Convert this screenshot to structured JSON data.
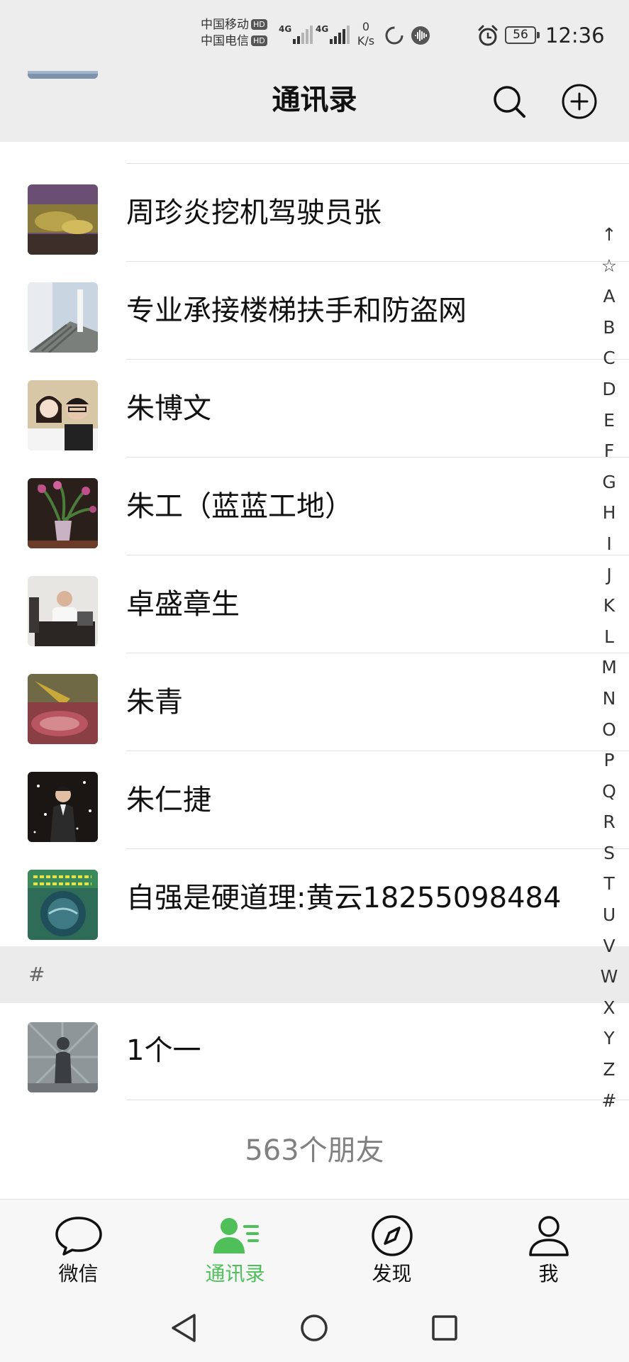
{
  "status_bar": {
    "carrier_1": "中国移动",
    "carrier_2": "中国电信",
    "hd_badge": "HD",
    "network_1": "4G",
    "network_2": "4G",
    "speed_value": "0",
    "speed_unit": "K/s",
    "battery": "56",
    "time": "12:36"
  },
  "header": {
    "title": "通讯录",
    "search_icon": "search-icon",
    "add_icon": "plus-circle-icon"
  },
  "contacts": [
    {
      "name": "周珍炎挖机驾驶员张"
    },
    {
      "name": "专业承接楼梯扶手和防盗网"
    },
    {
      "name": "朱博文"
    },
    {
      "name": "朱工（蓝蓝工地）"
    },
    {
      "name": "卓盛章生"
    },
    {
      "name": "朱青"
    },
    {
      "name": "朱仁捷"
    },
    {
      "name": "自强是硬道理:黄云18255098484"
    }
  ],
  "section_hash": {
    "label": "#",
    "contacts": [
      {
        "name": "1个一"
      }
    ]
  },
  "friend_count": "563个朋友",
  "index_letters": [
    "↑",
    "☆",
    "A",
    "B",
    "C",
    "D",
    "E",
    "F",
    "G",
    "H",
    "I",
    "J",
    "K",
    "L",
    "M",
    "N",
    "O",
    "P",
    "Q",
    "R",
    "S",
    "T",
    "U",
    "V",
    "W",
    "X",
    "Y",
    "Z",
    "#"
  ],
  "tabs": [
    {
      "label": "微信",
      "icon": "chat-bubble-icon",
      "active": false
    },
    {
      "label": "通讯录",
      "icon": "contacts-icon",
      "active": true
    },
    {
      "label": "发现",
      "icon": "compass-icon",
      "active": false
    },
    {
      "label": "我",
      "icon": "person-icon",
      "active": false
    }
  ],
  "colors": {
    "accent": "#4fbf5a",
    "header_bg": "#ededed",
    "tabbar_bg": "#f7f7f7"
  }
}
